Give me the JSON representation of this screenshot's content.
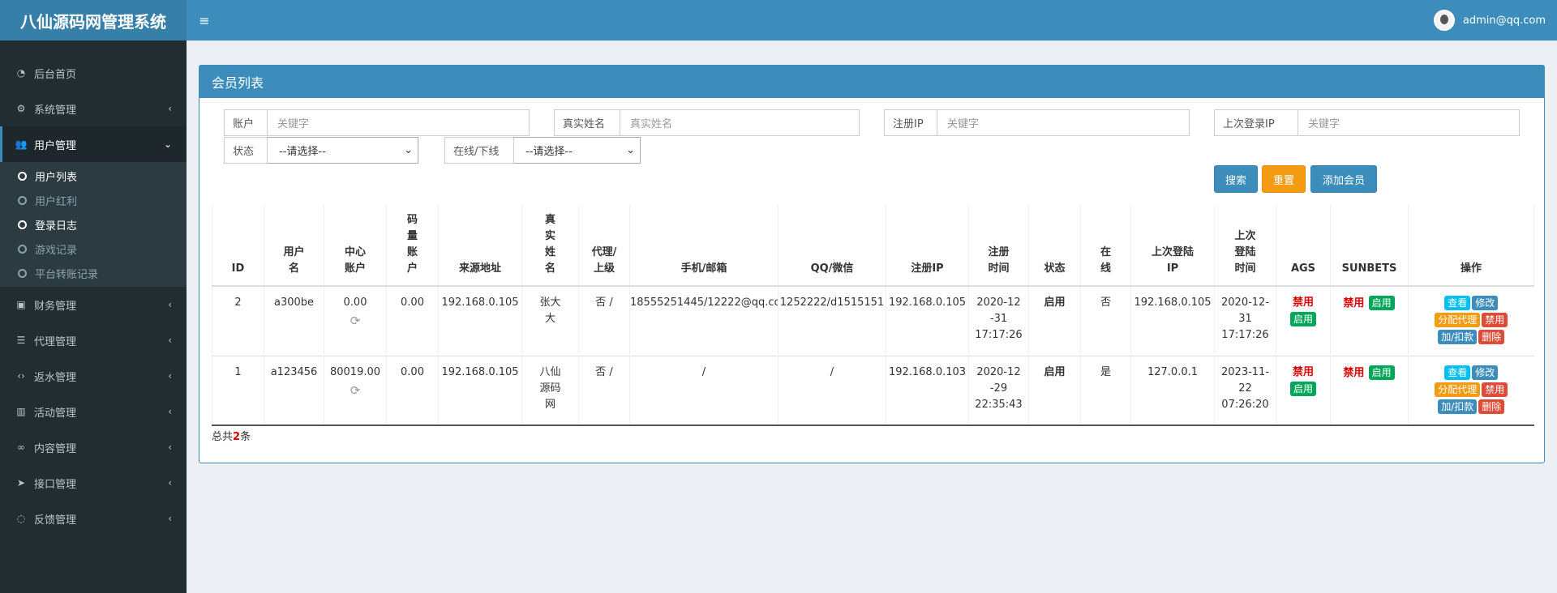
{
  "header": {
    "logo": "八仙源码网管理系统",
    "menu_icon": "≡",
    "user": "admin@qq.com"
  },
  "sidebar": {
    "items": [
      {
        "label": "后台首页",
        "icon": "dashboard-icon",
        "glyph": "◔"
      },
      {
        "label": "系统管理",
        "icon": "gear-icon",
        "glyph": "⚙",
        "chev": "‹"
      },
      {
        "label": "用户管理",
        "icon": "users-icon",
        "glyph": "👥",
        "chev": "⌄"
      },
      {
        "label": "财务管理",
        "icon": "money-icon",
        "glyph": "▣",
        "chev": "‹"
      },
      {
        "label": "代理管理",
        "icon": "list-icon",
        "glyph": "☰",
        "chev": "‹"
      },
      {
        "label": "返水管理",
        "icon": "code-icon",
        "glyph": "‹›",
        "chev": "‹"
      },
      {
        "label": "活动管理",
        "icon": "map-icon",
        "glyph": "▥",
        "chev": "‹"
      },
      {
        "label": "内容管理",
        "icon": "link-icon",
        "glyph": "∞",
        "chev": "‹"
      },
      {
        "label": "接口管理",
        "icon": "send-icon",
        "glyph": "➤",
        "chev": "‹"
      },
      {
        "label": "反馈管理",
        "icon": "comment-icon",
        "glyph": "◌",
        "chev": "‹"
      }
    ],
    "sub_items": [
      {
        "label": "用户列表"
      },
      {
        "label": "用户红利"
      },
      {
        "label": "登录日志"
      },
      {
        "label": "游戏记录"
      },
      {
        "label": "平台转账记录"
      }
    ]
  },
  "box": {
    "title": "会员列表"
  },
  "filters": {
    "account": {
      "label": "账户",
      "placeholder": "关键字"
    },
    "realname": {
      "label": "真实姓名",
      "placeholder": "真实姓名"
    },
    "reg_ip": {
      "label": "注册IP",
      "placeholder": "关键字"
    },
    "last_ip": {
      "label": "上次登录IP",
      "placeholder": "关键字"
    },
    "status": {
      "label": "状态",
      "value": "--请选择--"
    },
    "online": {
      "label": "在线/下线",
      "value": "--请选择--"
    },
    "caret": "⌄"
  },
  "buttons": {
    "search": "搜索",
    "reset": "重置",
    "add": "添加会员"
  },
  "table": {
    "headers": [
      "ID",
      "用户名",
      "中心账户",
      "码量账户",
      "来源地址",
      "真实姓名",
      "代理/上级",
      "手机/邮箱",
      "QQ/微信",
      "注册IP",
      "注册时间",
      "状态",
      "在线",
      "上次登陆IP",
      "上次登陆时间",
      "AGS",
      "SUNBETS",
      "操作"
    ],
    "refresh_glyph": "⟳",
    "rows": [
      {
        "id": "2",
        "username": "a300be",
        "center": "0.00",
        "code": "0.00",
        "source": "192.168.0.105",
        "realname": "张大大",
        "agent": "否 /",
        "phone": "18555251445/12222@qq.co",
        "qq": "1252222/d1515151",
        "reg_ip": "192.168.0.105",
        "reg_date": "2020-12-31",
        "reg_time": "17:17:26",
        "status": "启用",
        "online": "否",
        "last_ip": "192.168.0.105",
        "last_date": "2020-12-31",
        "last_time": "17:17:26",
        "ags_state": "禁用",
        "ags_btn": "启用",
        "sun_state": "禁用",
        "sun_btn": "启用"
      },
      {
        "id": "1",
        "username": "a123456",
        "center": "80019.00",
        "code": "0.00",
        "source": "192.168.0.105",
        "realname": "八仙源码网",
        "agent": "否 /",
        "phone": "/",
        "qq": "/",
        "reg_ip": "192.168.0.103",
        "reg_date": "2020-12-29",
        "reg_time": "22:35:43",
        "status": "启用",
        "online": "是",
        "last_ip": "127.0.0.1",
        "last_date": "2023-11-22",
        "last_time": "07:26:20",
        "ags_state": "禁用",
        "ags_btn": "启用",
        "sun_state": "禁用",
        "sun_btn": "启用"
      }
    ],
    "actions": {
      "view": "查看",
      "edit": "修改",
      "assign": "分配代理",
      "disable": "禁用",
      "adjust": "加/扣款",
      "delete": "删除"
    }
  },
  "footer": {
    "prefix": "总共",
    "count": "2",
    "suffix": "条"
  }
}
